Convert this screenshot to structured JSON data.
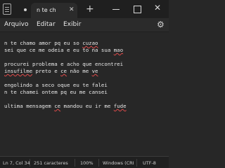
{
  "tab": {
    "title": "n te ch",
    "close": "✕"
  },
  "titlebar": {
    "add_tab": "+",
    "close": "✕"
  },
  "menu": {
    "file": "Arquivo",
    "edit": "Editar",
    "view": "Exibir"
  },
  "icons": {
    "settings": "gear-icon",
    "app": "notepad-icon"
  },
  "document": {
    "lines": [
      [
        "n te chamo amor pq eu so ",
        "cuzao"
      ],
      [
        "sei que ce me odeia e eu to na sua ",
        "mao"
      ],
      [
        "procurei problema e acho que encontrei"
      ],
      [
        "insufilme",
        " preto e ",
        "ce",
        " não me ",
        "ve"
      ],
      [
        "engolindo a seco oque eu te falei"
      ],
      [
        "n te chamei ontem pq eu me cansei"
      ],
      [
        "ultima mensagem ",
        "ce",
        " mandou eu ir me ",
        "fude"
      ]
    ]
  },
  "status": {
    "position": "Ln 7, Col 34",
    "chars": "251 caracteres",
    "zoom": "100%",
    "eol": "Windows (CRI",
    "encoding": "UTF-8"
  },
  "colors": {
    "background": "#272727",
    "spell_error": "#e04a4a"
  }
}
